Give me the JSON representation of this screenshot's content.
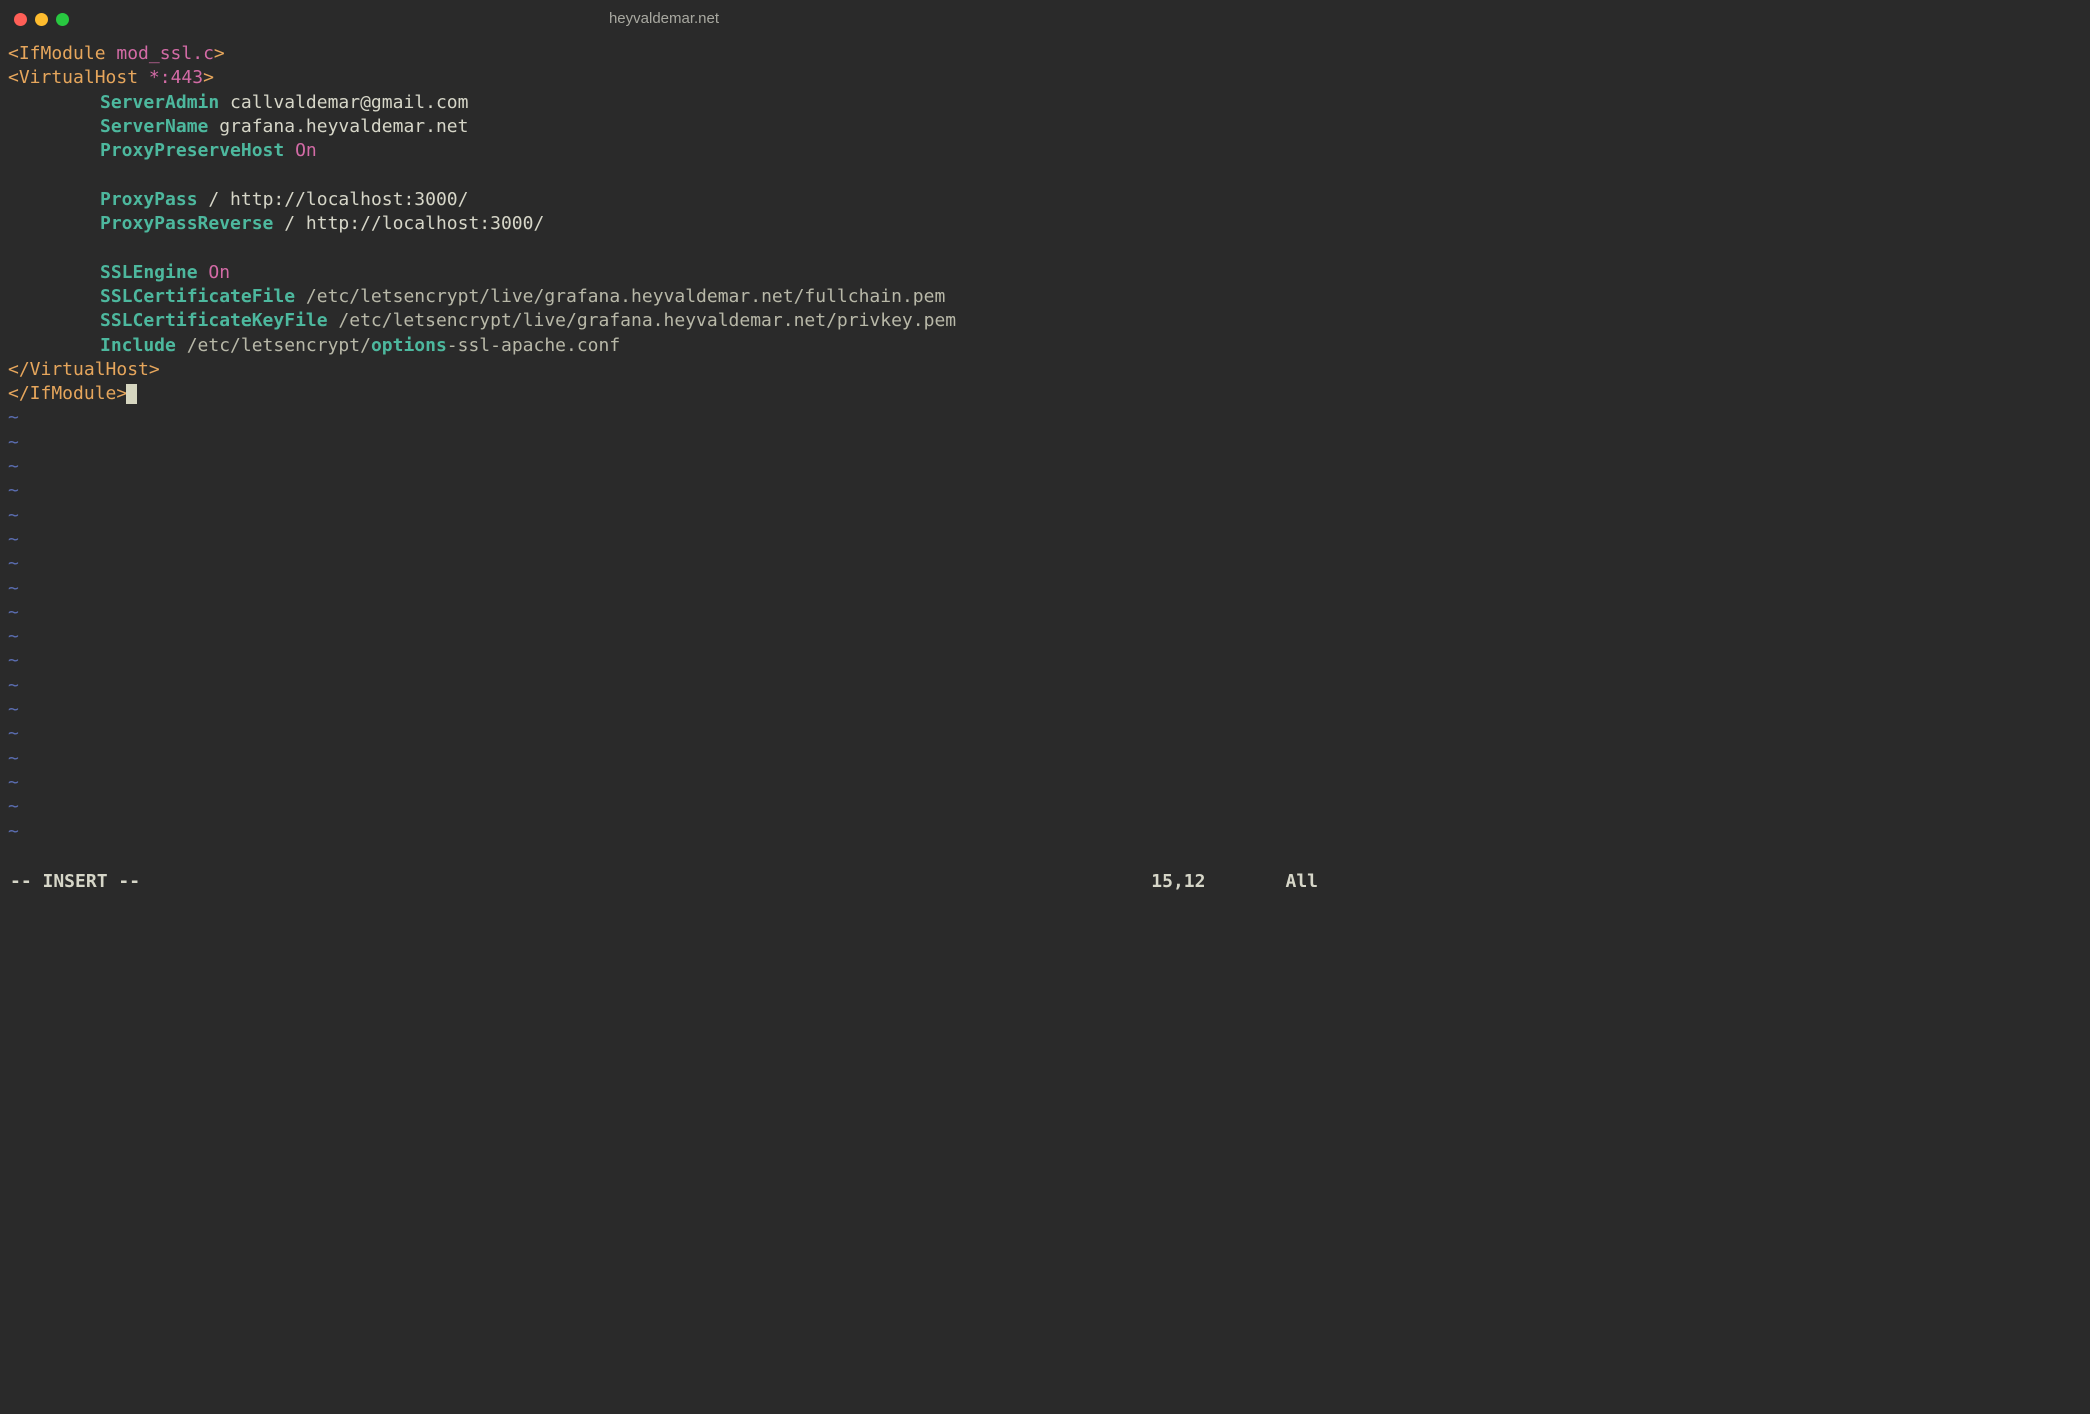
{
  "window": {
    "title": "heyvaldemar.net"
  },
  "code": {
    "l1_a": "<IfModule ",
    "l1_b": "mod_ssl.c",
    "l1_c": ">",
    "l2_a": "<VirtualHost ",
    "l2_b": "*:443",
    "l2_c": ">",
    "l3_a": "ServerAdmin",
    "l3_b": " callvaldemar@gmail.com",
    "l4_a": "ServerName",
    "l4_b": " grafana.heyvaldemar.net",
    "l5_a": "ProxyPreserveHost",
    "l5_b": " On",
    "l7_a": "ProxyPass",
    "l7_b": " / http://localhost:3000/",
    "l8_a": "ProxyPassReverse",
    "l8_b": " / http://localhost:3000/",
    "l10_a": "SSLEngine",
    "l10_b": " On",
    "l11_a": "SSLCertificateFile",
    "l11_b": " /etc/letsencrypt/live/grafana.heyvaldemar.net/fullchain.pem",
    "l12_a": "SSLCertificateKeyFile",
    "l12_b": " /etc/letsencrypt/live/grafana.heyvaldemar.net/privkey.pem",
    "l13_a": "Include",
    "l13_b": " /etc/letsencrypt/",
    "l13_c": "options",
    "l13_d": "-ssl-apache.conf",
    "l14": "</VirtualHost>",
    "l15": "</IfModule>",
    "tilde": "~"
  },
  "status": {
    "mode": "-- INSERT --",
    "position": "15,12",
    "view": "All"
  }
}
